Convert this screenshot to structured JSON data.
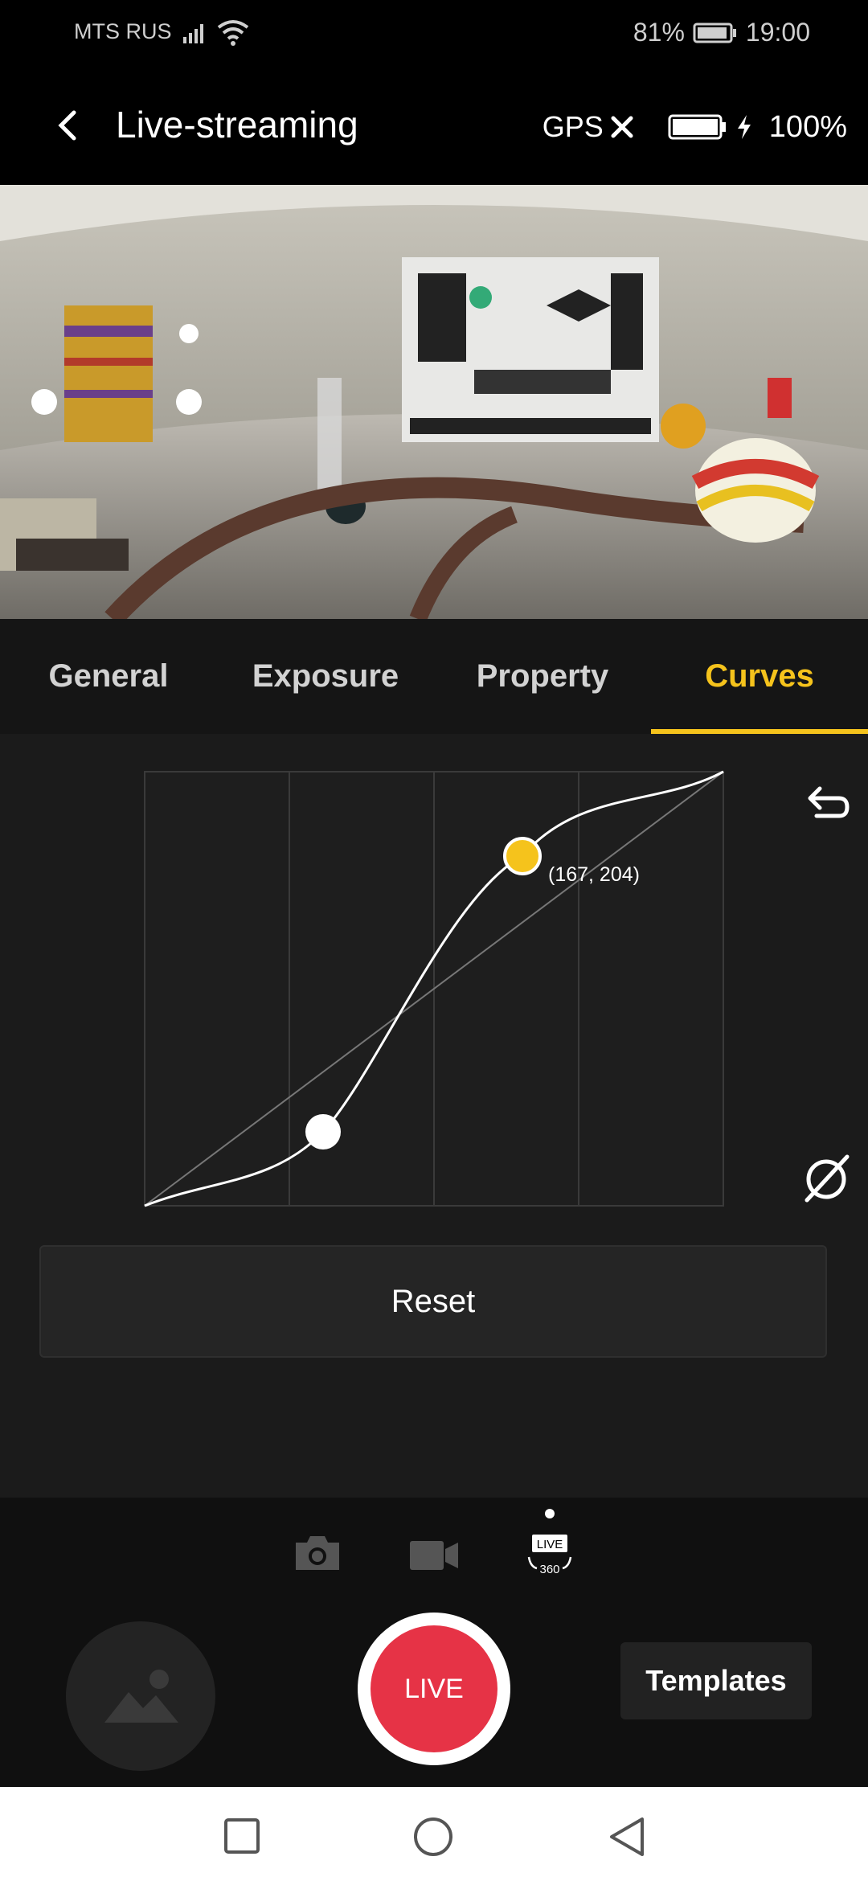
{
  "status_bar": {
    "carrier": "MTS RUS",
    "battery": "81%",
    "time": "19:00"
  },
  "app_bar": {
    "title": "Live-streaming",
    "gps_label": "GPS",
    "battery_percent": "100%"
  },
  "tabs": [
    {
      "label": "General",
      "active": false
    },
    {
      "label": "Exposure",
      "active": false
    },
    {
      "label": "Property",
      "active": false
    },
    {
      "label": "Curves",
      "active": true
    }
  ],
  "curves": {
    "active_point_label": "(167, 204)",
    "reset_label": "Reset",
    "accent_color": "#f5c31c"
  },
  "bottom": {
    "live_label": "LIVE",
    "live_badge": "LIVE",
    "live_badge_sub": "360",
    "templates_label": "Templates",
    "live_button_color": "#e63346"
  }
}
